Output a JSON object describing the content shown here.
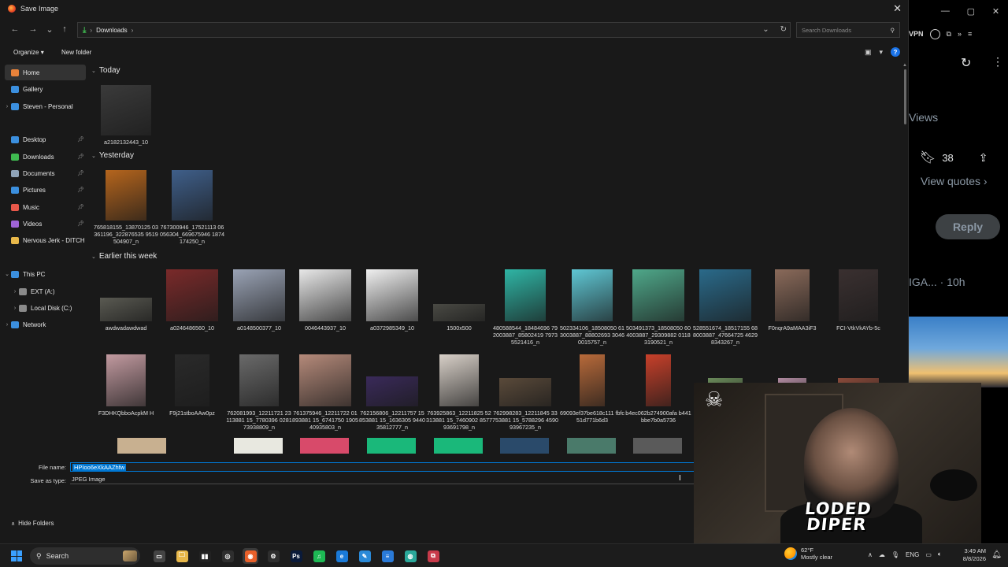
{
  "dialog": {
    "title": "Save Image",
    "close_glyph": "✕",
    "nav": {
      "back": "←",
      "forward": "→",
      "recent": "⌄",
      "up": "↑"
    },
    "breadcrumb": [
      {
        "icon": "download-icon",
        "label": "Downloads"
      }
    ],
    "search_placeholder": "Search Downloads",
    "toolbar": {
      "organize": "Organize",
      "new_folder": "New folder"
    },
    "sidebar": [
      {
        "label": "Home",
        "icon": "home-icon",
        "color": "#e8823a",
        "selected": true
      },
      {
        "label": "Gallery",
        "icon": "gallery-icon",
        "color": "#3b8fde"
      },
      {
        "label": "Steven - Personal",
        "icon": "cloud-icon",
        "color": "#3b8fde",
        "expandable": true
      },
      {
        "label": "Desktop",
        "icon": "desktop-icon",
        "color": "#3b8fde",
        "pinned": true
      },
      {
        "label": "Downloads",
        "icon": "download-icon",
        "color": "#3fb950",
        "pinned": true
      },
      {
        "label": "Documents",
        "icon": "documents-icon",
        "color": "#8fa3b8",
        "pinned": true
      },
      {
        "label": "Pictures",
        "icon": "pictures-icon",
        "color": "#3b8fde",
        "pinned": true
      },
      {
        "label": "Music",
        "icon": "music-icon",
        "color": "#e8584a",
        "pinned": true
      },
      {
        "label": "Videos",
        "icon": "videos-icon",
        "color": "#a064d8",
        "pinned": true
      },
      {
        "label": "Nervous Jerk - DITCH",
        "icon": "folder-icon",
        "color": "#e8b84a"
      },
      {
        "label": "This PC",
        "icon": "pc-icon",
        "color": "#3b8fde",
        "expanded": true
      },
      {
        "label": "EXT (A:)",
        "icon": "drive-icon",
        "color": "#8a8a8a",
        "expandable": true
      },
      {
        "label": "Local Disk (C:)",
        "icon": "drive-icon",
        "color": "#8a8a8a",
        "expandable": true
      },
      {
        "label": "Network",
        "icon": "network-icon",
        "color": "#3b8fde",
        "expandable": true
      }
    ],
    "groups": [
      {
        "label": "Today",
        "items": [
          {
            "name": "a2182132443_10",
            "thumb": "#3a3a3a",
            "w": 64,
            "h": 64
          }
        ]
      },
      {
        "label": "Yesterday",
        "items": [
          {
            "name": "765818155_13870125 03361196_322876535 9519504907_n",
            "thumb": "#b5651d",
            "w": 52,
            "h": 64
          },
          {
            "name": "767300946_17521113 06056304_669675946 1874174250_n",
            "thumb": "#3f5f8a",
            "w": 52,
            "h": 64
          }
        ]
      },
      {
        "label": "Earlier this week",
        "items": [
          {
            "name": "awdwadawdwad",
            "thumb": "#5a5a52",
            "w": 66,
            "h": 30
          },
          {
            "name": "a0246486560_10",
            "thumb": "#7a2a2a",
            "w": 66,
            "h": 66
          },
          {
            "name": "a0148500377_10",
            "thumb": "#9aa3b5",
            "w": 66,
            "h": 66
          },
          {
            "name": "0046443937_10",
            "thumb": "#e8e8e8",
            "w": 66,
            "h": 66
          },
          {
            "name": "a0372985349_10",
            "thumb": "#f0f0f0",
            "w": 66,
            "h": 66
          },
          {
            "name": "1500x500",
            "thumb": "#4a4a44",
            "w": 66,
            "h": 22
          },
          {
            "name": "480588544_18484696 792003887_85802419 79735521416_n",
            "thumb": "#2fb5a5",
            "w": 52,
            "h": 66
          },
          {
            "name": "502334106_18508050 613003887_88802693 30460015757_n",
            "thumb": "#5fc7d4",
            "w": 52,
            "h": 66
          },
          {
            "name": "503491373_18508050 604003887_29309882 01183190521_n",
            "thumb": "#4fa88a",
            "w": 66,
            "h": 66
          },
          {
            "name": "528551674_18517155 688003887_47664725 46298343267_n",
            "thumb": "#2a6a8a",
            "w": 66,
            "h": 66
          },
          {
            "name": "F0nqrA9aMAA3iF3",
            "thumb": "#8a6a5a",
            "w": 44,
            "h": 66
          },
          {
            "name": "FCI-VtkVkAYb-5c",
            "thumb": "#3a3030",
            "w": 50,
            "h": 66
          },
          {
            "name": "F3DHKQbboAcpkM H",
            "thumb": "#c29aa0",
            "w": 50,
            "h": 66
          },
          {
            "name": "F9j21stboAAw0pz",
            "thumb": "#2a2a2a",
            "w": 44,
            "h": 66
          },
          {
            "name": "762081993_12211721 23113881 15_7780396 028173938809_n",
            "thumb": "#6a6a6a",
            "w": 50,
            "h": 66
          },
          {
            "name": "761375946_12211722 01893881 15_6741750 190540935803_n",
            "thumb": "#b58a7a",
            "w": 66,
            "h": 66
          },
          {
            "name": "762156806_12211757 15853881 15_1636305 944035812777_n",
            "thumb": "#3a2a5a",
            "w": 66,
            "h": 38
          },
          {
            "name": "763925863_12211825 52313881 15_7460902 857793691798_n",
            "thumb": "#d8d0c8",
            "w": 50,
            "h": 66
          },
          {
            "name": "762998283_12211845 33753881 15_5788296 459093967235_n",
            "thumb": "#5a4a3a",
            "w": 66,
            "h": 36
          },
          {
            "name": "69093ef37be618c111 fbfc51d771b6d3",
            "thumb": "#b86a3a",
            "w": 32,
            "h": 66
          },
          {
            "name": "b4ec062b274900afa b441bbe7b0a5736",
            "thumb": "#c8402a",
            "w": 32,
            "h": 66
          },
          {
            "name": "",
            "thumb": "#6a8a5a",
            "w": 44,
            "h": 36
          },
          {
            "name": "",
            "thumb": "#b08aa0",
            "w": 36,
            "h": 36
          },
          {
            "name": "",
            "thumb": "#8a4a3a",
            "w": 52,
            "h": 36
          }
        ],
        "partial_row": [
          {
            "thumb": "#c8b090"
          },
          {
            "thumb": "#e8e8e0"
          },
          {
            "thumb": "#d84a6a"
          },
          {
            "thumb": "#1ab87a"
          },
          {
            "thumb": "#1ab87a"
          },
          {
            "thumb": "#2a4a6a"
          },
          {
            "thumb": "#4a7a6a"
          },
          {
            "thumb": "#5a5a5a"
          }
        ]
      }
    ],
    "file_name_label": "File name:",
    "file_name_value": "HPIoo6eXkAAZhfw",
    "save_as_type_label": "Save as type:",
    "save_as_type_value": "JPEG Image",
    "hide_folders": "Hide Folders"
  },
  "background_browser": {
    "vpn": "VPN",
    "views": "Views",
    "bookmarks": "38",
    "view_quotes": "View quotes",
    "reply": "Reply",
    "handle": "IGA... · 10h"
  },
  "webcam": {
    "logo_line1": "LODED",
    "logo_line2": "DIPER"
  },
  "taskbar": {
    "search": "Search",
    "weather_temp": "62°F",
    "weather_desc": "Mostly clear",
    "lang": "ENG",
    "time": "3:49 AM",
    "date": "8/8/2026",
    "apps": [
      {
        "name": "task-view-icon",
        "label": "▭",
        "bg": "#444"
      },
      {
        "name": "file-explorer-icon",
        "label": "🗀",
        "bg": "#e8b84a"
      },
      {
        "name": "audio-app-icon",
        "label": "▮▮",
        "bg": "#222"
      },
      {
        "name": "chrome-icon",
        "label": "◎",
        "bg": "#2e2e2e"
      },
      {
        "name": "firefox-icon",
        "label": "◉",
        "bg": "#e8602a",
        "active": true
      },
      {
        "name": "settings-icon",
        "label": "⚙",
        "bg": "#2e2e2e"
      },
      {
        "name": "photoshop-icon",
        "label": "Ps",
        "bg": "#0a1a3a"
      },
      {
        "name": "spotify-icon",
        "label": "♫",
        "bg": "#1db954"
      },
      {
        "name": "edge-icon",
        "label": "e",
        "bg": "#1a7ad8"
      },
      {
        "name": "paint-icon",
        "label": "✎",
        "bg": "#2a8ad8"
      },
      {
        "name": "notepad-icon",
        "label": "≡",
        "bg": "#2a7ad8"
      },
      {
        "name": "globe-icon",
        "label": "◍",
        "bg": "#2aa89a"
      },
      {
        "name": "app-icon",
        "label": "⧉",
        "bg": "#c83a4a"
      }
    ]
  }
}
